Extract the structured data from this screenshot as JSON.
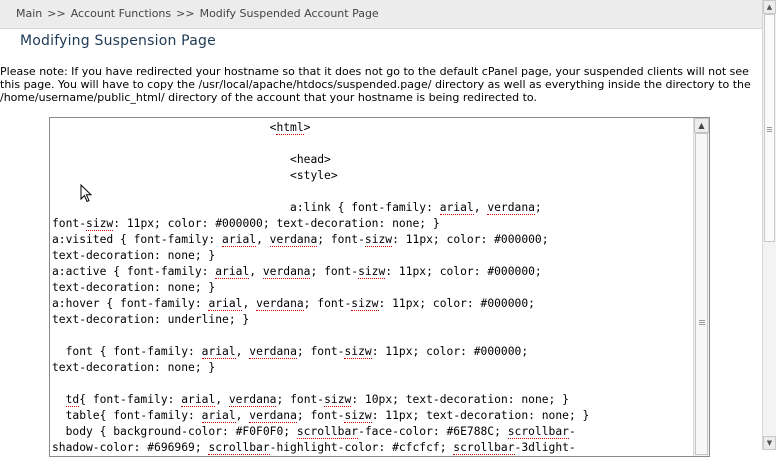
{
  "breadcrumb": {
    "items": [
      "Main",
      "Account Functions",
      "Modify Suspended Account Page"
    ],
    "separator": ">>"
  },
  "page": {
    "title": "Modifying Suspension Page",
    "note": "Please note: If you have redirected your hostname so that it does not go to the default cPanel page, your suspended clients will not see this page. You will have to copy the /usr/local/apache/htdocs/suspended.page/ directory as well as everything inside the directory to the /home/username/public_html/ directory of the account that your hostname is being redirected to."
  },
  "editor": {
    "lines": [
      "                                <html>",
      "",
      "                                   <head>",
      "                                   <style>",
      "",
      "                                   a:link { font-family: arial, verdana;",
      "font-sizw: 11px; color: #000000; text-decoration: none; }",
      "a:visited { font-family: arial, verdana; font-sizw: 11px; color: #000000;",
      "text-decoration: none; }",
      "a:active { font-family: arial, verdana; font-sizw: 11px; color: #000000;",
      "text-decoration: none; }",
      "a:hover { font-family: arial, verdana; font-sizw: 11px; color: #000000;",
      "text-decoration: underline; }",
      "",
      "  font { font-family: arial, verdana; font-sizw: 11px; color: #000000;",
      "text-decoration: none; }",
      "",
      "  td{ font-family: arial, verdana; font-sizw: 10px; text-decoration: none; }",
      "  table{ font-family: arial, verdana; font-sizw: 11px; text-decoration: none; }",
      "  body { background-color: #F0F0F0; scrollbar-face-color: #6E788C; scrollbar-",
      "shadow-color: #696969; scrollbar-highlight-color: #cfcfcf; scrollbar-3dlight-"
    ],
    "spellcheck_words": [
      "html",
      "arial",
      "verdana",
      "sizw",
      "td",
      "scrollbar"
    ]
  },
  "colors": {
    "breadcrumb_bg": "#ececec",
    "title": "#1f3a55",
    "spell_underline": "#d00000"
  },
  "icons": {
    "scroll_up": "triangle-up",
    "scroll_down": "triangle-down",
    "cursor": "arrow-pointer"
  }
}
